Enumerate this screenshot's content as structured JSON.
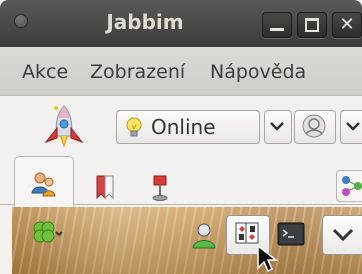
{
  "window": {
    "title": "Jabbim"
  },
  "menu": {
    "items": [
      "Akce",
      "Zobrazení",
      "Nápověda"
    ]
  },
  "status": {
    "label": "Online"
  },
  "colors": {
    "titlebar": "#3c3b37",
    "menubar": "#d6d4cf",
    "background": "#f2f1f0"
  }
}
